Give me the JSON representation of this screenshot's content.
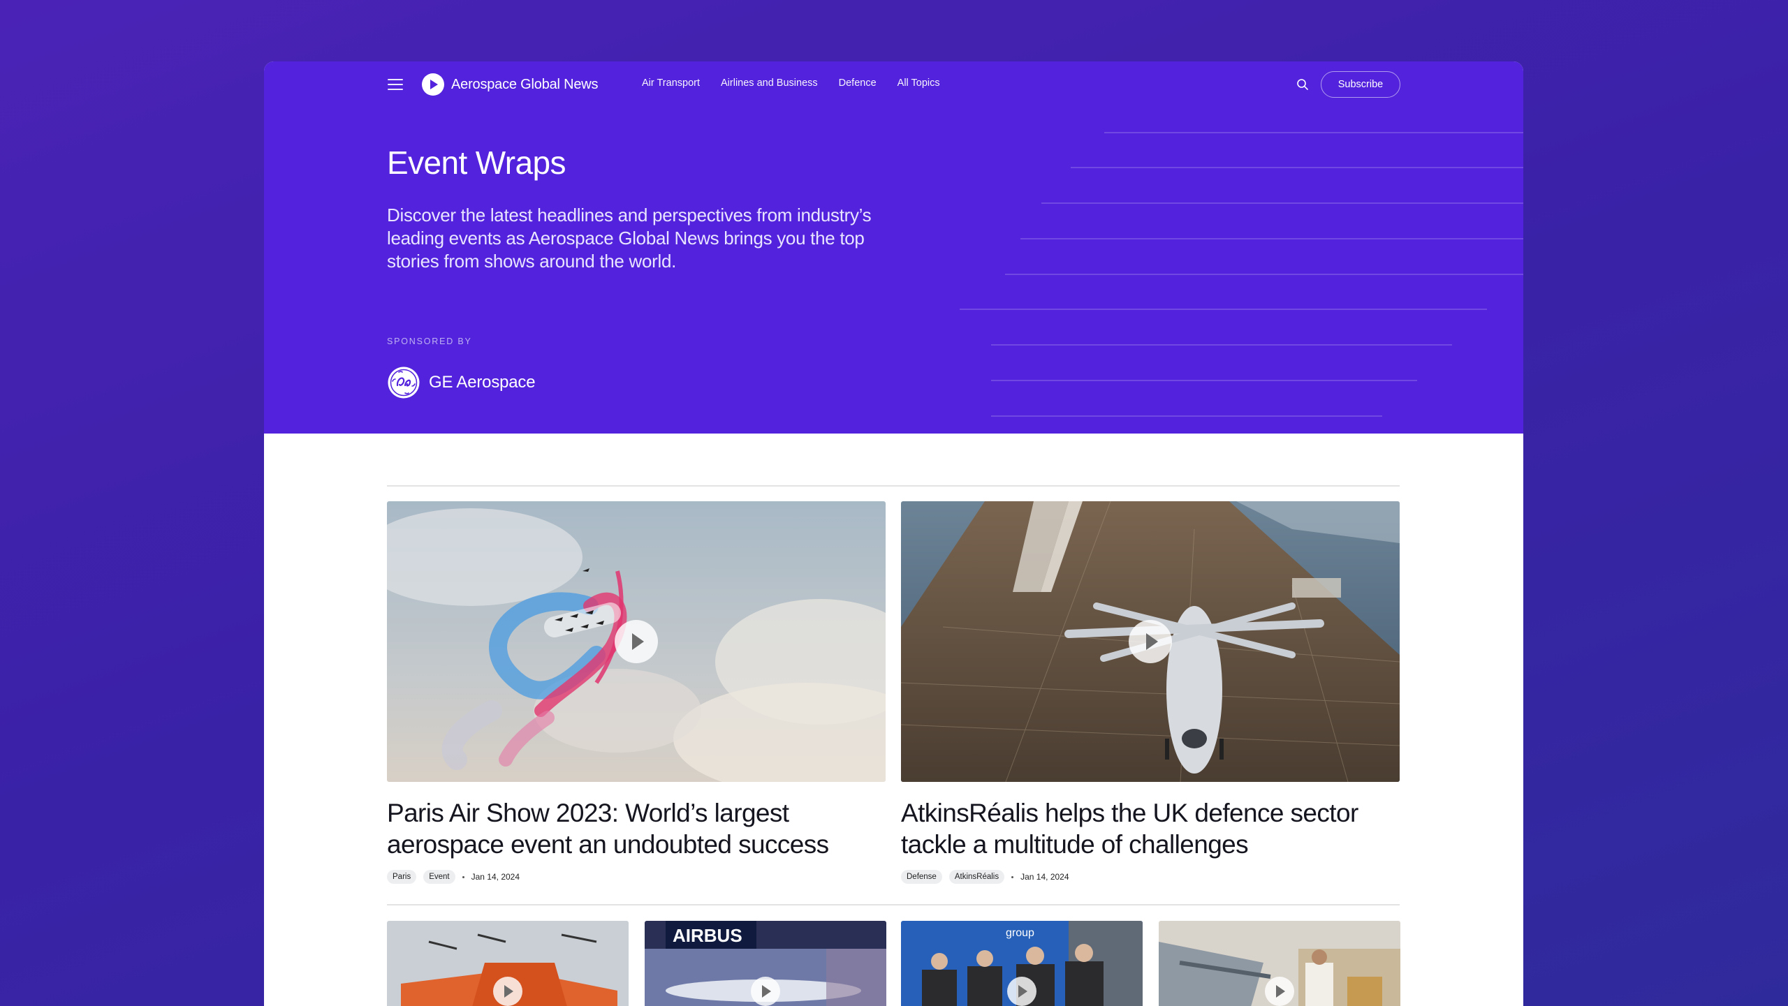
{
  "header": {
    "brand": "Aerospace Global News",
    "nav": [
      "Air Transport",
      "Airlines and Business",
      "Defence",
      "All Topics"
    ],
    "subscribe_label": "Subscribe"
  },
  "hero": {
    "title": "Event Wraps",
    "description": "Discover the latest headlines and perspectives from industry’s leading events as Aerospace Global News brings you the top stories from shows around the world.",
    "sponsored_label": "SPONSORED BY",
    "sponsor_name": "GE Aerospace"
  },
  "featured": [
    {
      "title": "Paris Air Show 2023: World’s largest aerospace event an undoubted success",
      "tags": [
        "Paris",
        "Event"
      ],
      "date": "Jan 14, 2024"
    },
    {
      "title": "AtkinsRéalis helps the UK defence sector tackle a multitude of challenges",
      "tags": [
        "Defense",
        "AtkinsRéalis"
      ],
      "date": "Jan 14, 2024"
    }
  ],
  "thumbnails": [
    {
      "caption": ""
    },
    {
      "caption": "AIRBUS"
    },
    {
      "caption": "group"
    },
    {
      "caption": ""
    }
  ],
  "colors": {
    "hero_bg": "#5222dc",
    "page_bg": "#4a23b6",
    "text_dark": "#15151f"
  }
}
